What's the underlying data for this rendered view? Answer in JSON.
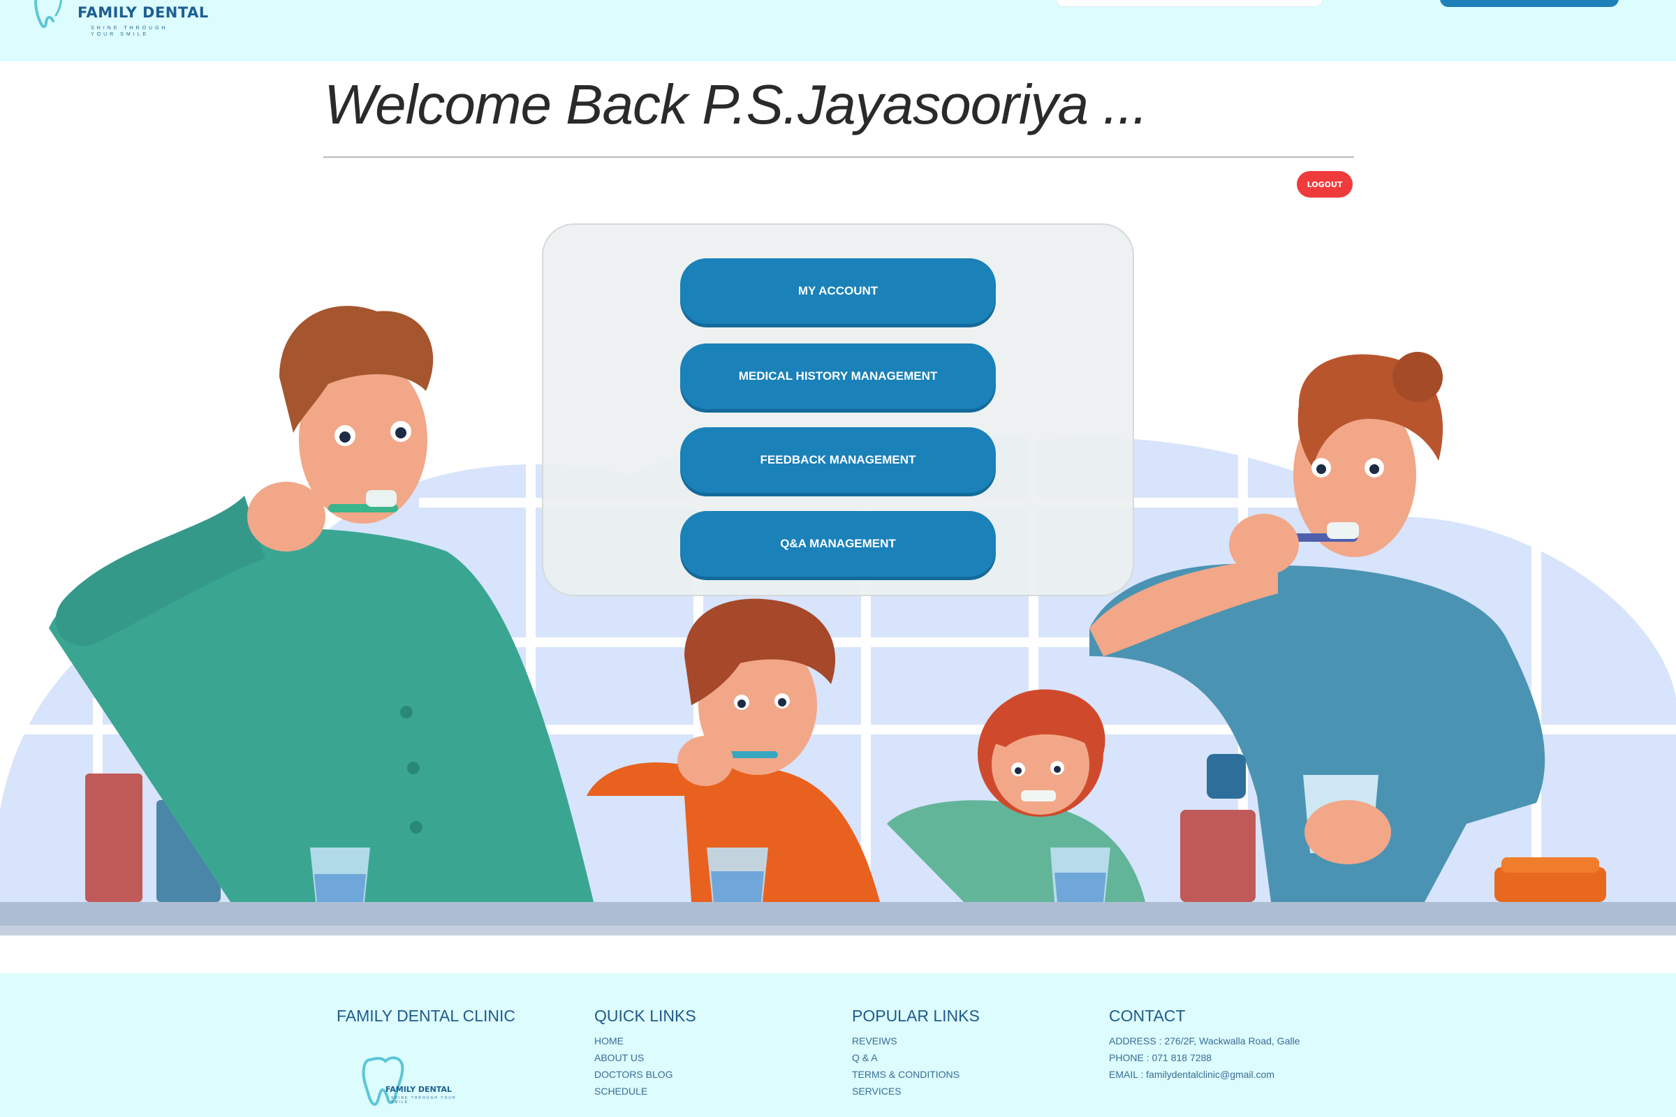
{
  "header": {
    "brand": "FAMILY DENTAL",
    "tagline_1": "SHINE THROUGH",
    "tagline_2": "YOUR SMILE"
  },
  "welcome": {
    "text": "Welcome Back P.S.Jayasooriya ..."
  },
  "logout_label": "LOGOUT",
  "menu": {
    "items": [
      {
        "label": "MY ACCOUNT"
      },
      {
        "label": "MEDICAL HISTORY MANAGEMENT"
      },
      {
        "label": "FEEDBACK MANAGEMENT"
      },
      {
        "label": "Q&A MANAGEMENT"
      }
    ]
  },
  "footer": {
    "clinic": {
      "title": "FAMILY DENTAL CLINIC",
      "logo_brand": "FAMILY DENTAL",
      "logo_tagline": "SHINE THROUGH YOUR SMILE"
    },
    "quick_links": {
      "title": "QUICK LINKS",
      "items": [
        "HOME",
        "ABOUT US",
        "DOCTORS BLOG",
        "SCHEDULE"
      ]
    },
    "popular_links": {
      "title": "POPULAR LINKS",
      "items": [
        "REVEIWS",
        "Q & A",
        "TERMS & CONDITIONS",
        "SERVICES"
      ]
    },
    "contact": {
      "title": "CONTACT",
      "items": [
        "ADDRESS : 276/2F, Wackwalla Road, Galle",
        "PHONE : 071 818 7288",
        "EMAIL : familydentalclinic@gmail.com"
      ]
    }
  },
  "colors": {
    "header_bg": "#dcfcfd",
    "primary_button": "#1a81b9",
    "logout": "#ef3b3b",
    "brand_text": "#1d5f93"
  }
}
